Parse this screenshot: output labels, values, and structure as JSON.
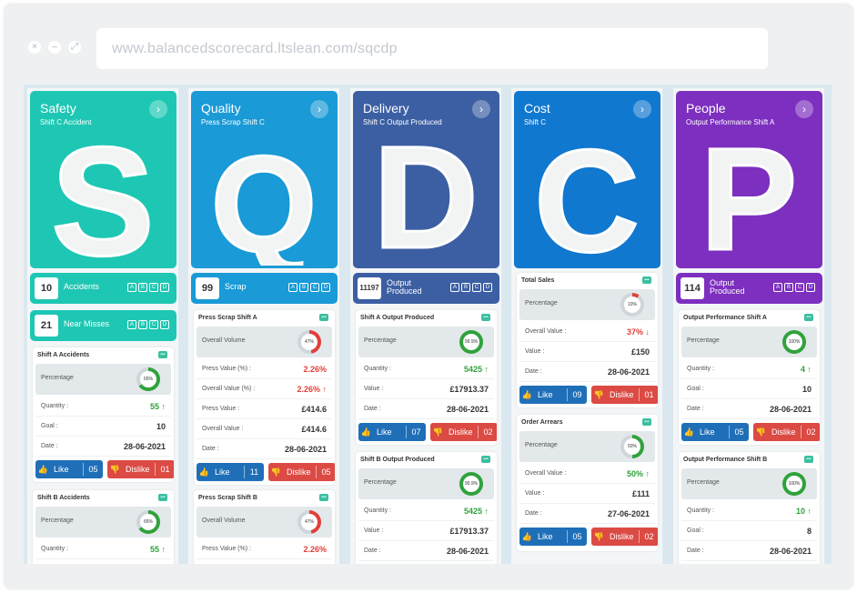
{
  "browser": {
    "url": "www.balancedscorecard.ltslean.com/sqcdp"
  },
  "colors": {
    "safety": "#1ec7b3",
    "quality": "#1a9ad6",
    "delivery": "#3c5fa3",
    "cost": "#1178cf",
    "people": "#7d2fbf",
    "green": "#2fa23c",
    "red": "#e0403a",
    "orange": "#e8a33d"
  },
  "safety": {
    "title": "Safety",
    "subtitle": "Shift C Accident",
    "letter": "S",
    "kpis": [
      {
        "value": "10",
        "label": "Accidents"
      },
      {
        "value": "21",
        "label": "Near Misses"
      }
    ],
    "abcd": [
      "A",
      "B",
      "C",
      "D"
    ],
    "cards": [
      {
        "title": "Shift A Accidents",
        "percent_label": "Percentage",
        "ring": "65%",
        "ring_value": 0.65,
        "rows": [
          {
            "label": "Quantity :",
            "value": "55 ↑"
          },
          {
            "label": "Goal :",
            "value": "10"
          },
          {
            "label": "Date :",
            "value": "28-06-2021"
          }
        ],
        "like": {
          "label": "Like",
          "count": "05"
        },
        "dislike": {
          "label": "Dislike",
          "count": "01"
        }
      },
      {
        "title": "Shift B Accidents",
        "percent_label": "Percentage",
        "ring": "65%",
        "ring_value": 0.65,
        "rows": [
          {
            "label": "Quantity :",
            "value": "55 ↑"
          }
        ]
      }
    ]
  },
  "quality": {
    "title": "Quality",
    "subtitle": "Press Scrap Shift C",
    "letter": "Q",
    "kpi": {
      "value": "99",
      "label": "Scrap"
    },
    "cards": [
      {
        "title": "Press Scrap Shift A",
        "percent_label": "Overall Volume",
        "ring": "47%",
        "ring_value": 0.47,
        "rows": [
          {
            "label": "Press Value (%) :",
            "value": "2.26%"
          },
          {
            "label": "Overall Value (%) :",
            "value": "2.26% ↑"
          },
          {
            "label": "Press Value :",
            "value": "£414.6"
          },
          {
            "label": "Overall Value :",
            "value": "£414.6"
          },
          {
            "label": "Date :",
            "value": "28-06-2021"
          }
        ],
        "like": {
          "label": "Like",
          "count": "11"
        },
        "dislike": {
          "label": "Dislike",
          "count": "05"
        }
      },
      {
        "title": "Press Scrap Shift B",
        "percent_label": "Overall Volume",
        "ring": "47%",
        "ring_value": 0.47,
        "rows": [
          {
            "label": "Press Value (%) :",
            "value": "2.26%"
          }
        ]
      }
    ]
  },
  "delivery": {
    "title": "Delivery",
    "subtitle": "Shift C Output Produced",
    "letter": "D",
    "kpi": {
      "value": "11197",
      "label_1": "Output",
      "label_2": "Produced"
    },
    "cards": [
      {
        "title": "Shift A Output Produced",
        "percent_label": "Percentage",
        "ring": "99.9%",
        "ring_value": 0.999,
        "rows": [
          {
            "label": "Quantity :",
            "value": "5425 ↑"
          },
          {
            "label": "Value :",
            "value": "£17913.37"
          },
          {
            "label": "Date :",
            "value": "28-06-2021"
          }
        ],
        "like": {
          "label": "Like",
          "count": "07"
        },
        "dislike": {
          "label": "Dislike",
          "count": "02"
        }
      },
      {
        "title": "Shift B Output Produced",
        "percent_label": "Percentage",
        "ring": "99.9%",
        "ring_value": 0.999,
        "rows": [
          {
            "label": "Quantity :",
            "value": "5425 ↑"
          },
          {
            "label": "Value :",
            "value": "£17913.37"
          },
          {
            "label": "Date :",
            "value": "28-06-2021"
          }
        ]
      }
    ]
  },
  "cost": {
    "title": "Cost",
    "subtitle": "Shift C",
    "letter": "C",
    "cards": [
      {
        "title": "Total Sales",
        "percent_label": "Percentage",
        "ring": "10%",
        "ring_value": 0.1,
        "rows": [
          {
            "label": "Overall Value :",
            "value": "37% ↓"
          },
          {
            "label": "Value :",
            "value": "£150"
          },
          {
            "label": "Date :",
            "value": "28-06-2021"
          }
        ],
        "like": {
          "label": "Like",
          "count": "09"
        },
        "dislike": {
          "label": "Dislike",
          "count": "01"
        }
      },
      {
        "title": "Order Arrears",
        "percent_label": "Percentage",
        "ring": "50%",
        "ring_value": 0.5,
        "rows": [
          {
            "label": "Overall Value :",
            "value": "50% ↑"
          },
          {
            "label": "Value :",
            "value": "£111"
          },
          {
            "label": "Date :",
            "value": "27-06-2021"
          }
        ],
        "like": {
          "label": "Like",
          "count": "05"
        },
        "dislike": {
          "label": "Dislike",
          "count": "02"
        }
      }
    ]
  },
  "people": {
    "title": "People",
    "subtitle": "Output Performance Shift A",
    "letter": "P",
    "kpi": {
      "value": "114",
      "label_1": "Output",
      "label_2": "Produced"
    },
    "cards": [
      {
        "title": "Output Performance Shift A",
        "percent_label": "Percentage",
        "ring": "100%",
        "ring_value": 1.0,
        "rows": [
          {
            "label": "Quantity :",
            "value": "4 ↑"
          },
          {
            "label": "Goal :",
            "value": "10"
          },
          {
            "label": "Date :",
            "value": "28-06-2021"
          }
        ],
        "like": {
          "label": "Like",
          "count": "05"
        },
        "dislike": {
          "label": "Dislike",
          "count": "02"
        }
      },
      {
        "title": "Output Performance Shift B",
        "percent_label": "Percentage",
        "ring": "100%",
        "ring_value": 1.0,
        "rows": [
          {
            "label": "Quantity :",
            "value": "10 ↑"
          },
          {
            "label": "Goal :",
            "value": "8"
          },
          {
            "label": "Date :",
            "value": "28-06-2021"
          }
        ]
      }
    ]
  },
  "icons": {
    "close": "close-icon",
    "minimize": "minimize-icon",
    "maximize": "maximize-icon",
    "arrow": "chevron-right-icon",
    "like": "thumbs-up-icon",
    "dislike": "thumbs-down-icon",
    "comment": "comment-icon"
  }
}
